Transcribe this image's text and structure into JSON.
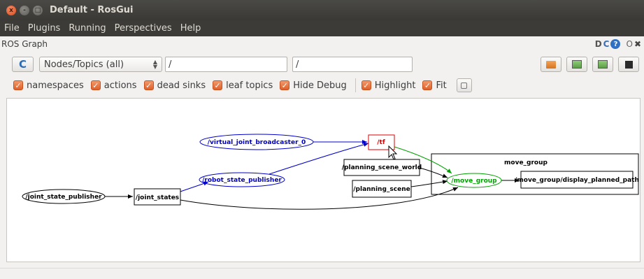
{
  "window": {
    "title": "Default - RosGui",
    "close_glyph": "x",
    "min_glyph": "-",
    "max_glyph": "□"
  },
  "menu": {
    "items": [
      "File",
      "Plugins",
      "Running",
      "Perspectives",
      "Help"
    ]
  },
  "plugin": {
    "title": "ROS Graph",
    "controls": {
      "d": "D",
      "c": "C",
      "help": "?",
      "o": "O",
      "x": "✖"
    }
  },
  "toolbar": {
    "refresh_glyph": "C",
    "graph_type": "Nodes/Topics (all)",
    "node_filter": "/",
    "topic_filter": "/"
  },
  "options": {
    "namespaces": "namespaces",
    "actions": "actions",
    "dead_sinks": "dead sinks",
    "leaf_topics": "leaf topics",
    "hide_debug": "Hide Debug",
    "highlight": "Highlight",
    "fit": "Fit"
  },
  "graph": {
    "colors": {
      "node": "#000000",
      "highlight_node": "#0000ff",
      "highlight_topic": "#ff0000",
      "selected": "#00a000"
    },
    "nodes": {
      "virtual_joint_broadcaster": "/virtual_joint_broadcaster_0",
      "tf": "/tf",
      "planning_scene_world": "/planning_scene_world",
      "robot_state_publisher": "/robot_state_publisher",
      "planning_scene": "/planning_scene",
      "joint_state_publisher": "/joint_state_publisher",
      "joint_states": "/joint_states",
      "move_group": "/move_group",
      "display_planned_path": "/move_group/display_planned_path"
    },
    "cluster_label": "move_group"
  }
}
